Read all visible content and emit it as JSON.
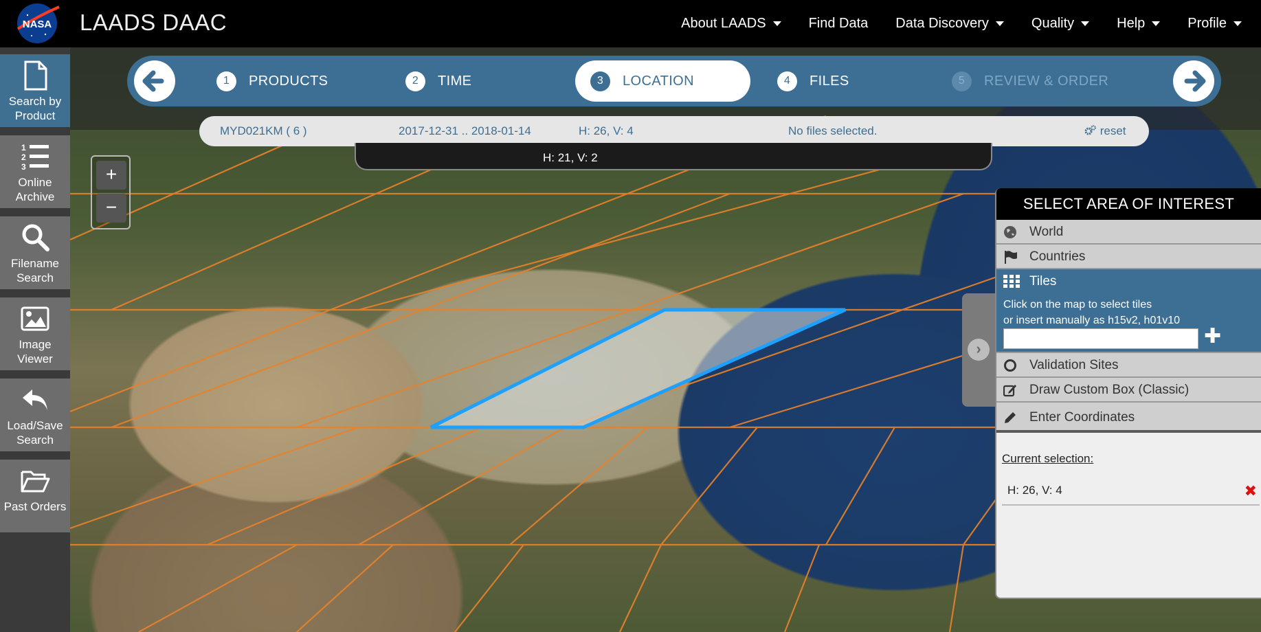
{
  "header": {
    "logo_text": "NASA",
    "title": "LAADS DAAC",
    "nav": [
      {
        "label": "About LAADS",
        "dropdown": true
      },
      {
        "label": "Find Data",
        "dropdown": false
      },
      {
        "label": "Data Discovery",
        "dropdown": true
      },
      {
        "label": "Quality",
        "dropdown": true
      },
      {
        "label": "Help",
        "dropdown": true
      },
      {
        "label": "Profile",
        "dropdown": true
      }
    ]
  },
  "sidebar": {
    "items": [
      {
        "label": "Search by Product",
        "icon": "document-icon",
        "active": true
      },
      {
        "label": "Online Archive",
        "icon": "numbered-list-icon"
      },
      {
        "label": "Filename Search",
        "icon": "search-icon"
      },
      {
        "label": "Image Viewer",
        "icon": "image-icon"
      },
      {
        "label": "Load/Save Search",
        "icon": "reply-icon"
      },
      {
        "label": "Past Orders",
        "icon": "folder-open-icon"
      }
    ]
  },
  "steps": [
    {
      "num": "1",
      "label": "PRODUCTS",
      "state": "done"
    },
    {
      "num": "2",
      "label": "TIME",
      "state": "done"
    },
    {
      "num": "3",
      "label": "LOCATION",
      "state": "active"
    },
    {
      "num": "4",
      "label": "FILES",
      "state": "todo"
    },
    {
      "num": "5",
      "label": "REVIEW & ORDER",
      "state": "disabled"
    }
  ],
  "summary": {
    "product": "MYD021KM ( 6 )",
    "daterange": "2017-12-31 .. 2018-01-14",
    "tile": "H: 26, V: 4",
    "files": "No files selected.",
    "reset": "reset"
  },
  "hover_info": "H: 21, V: 2",
  "zoom": {
    "in": "+",
    "out": "−"
  },
  "panel": {
    "title": "SELECT AREA OF INTEREST",
    "options": {
      "world": "World",
      "countries": "Countries",
      "tiles": "Tiles",
      "tiles_help_1": "Click on the map to select tiles",
      "tiles_help_2": "or insert manually as h15v2, h01v10",
      "tiles_input_value": "",
      "validation": "Validation Sites",
      "custom_box": "Draw Custom Box (Classic)",
      "coordinates": "Enter Coordinates"
    },
    "current_title": "Current selection:",
    "current_value": "H: 26, V: 4"
  },
  "colors": {
    "accent": "#3d6f94",
    "grid_line": "#e8822a",
    "selection": "#1ea0ff",
    "delete": "#e01010"
  }
}
